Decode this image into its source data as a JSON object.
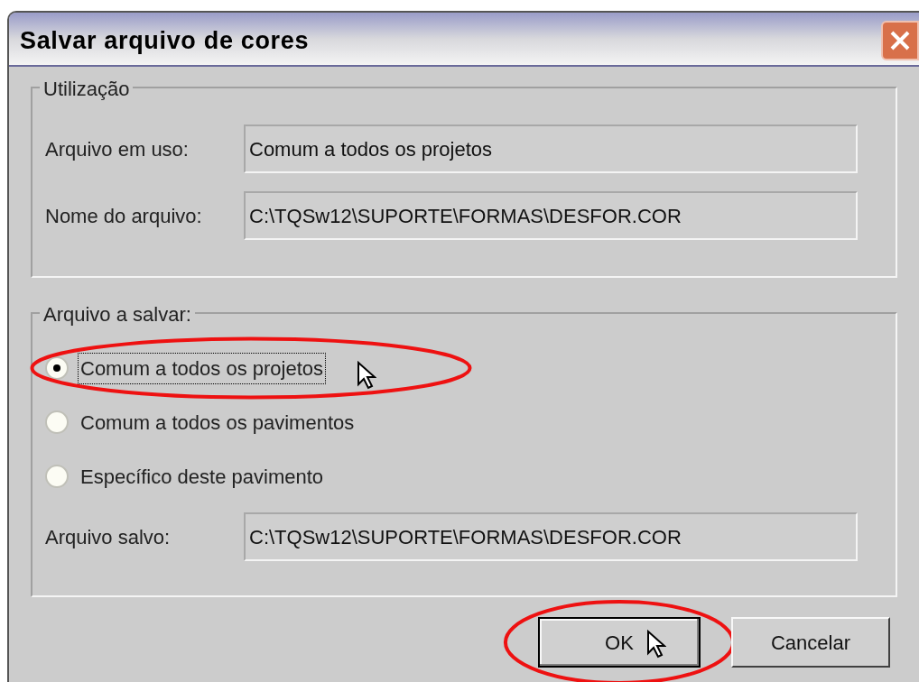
{
  "window": {
    "title": "Salvar arquivo de cores"
  },
  "usage_group": {
    "legend": "Utilização",
    "rows": [
      {
        "label": "Arquivo em uso:",
        "value": "Comum a todos os projetos"
      },
      {
        "label": "Nome do arquivo:",
        "value": "C:\\TQSw12\\SUPORTE\\FORMAS\\DESFOR.COR"
      }
    ]
  },
  "save_group": {
    "legend": "Arquivo a salvar:",
    "options": [
      {
        "label": "Comum a todos os projetos",
        "selected": true,
        "focused": true,
        "highlighted": true,
        "cursor": true
      },
      {
        "label": "Comum a todos os pavimentos",
        "selected": false,
        "focused": false,
        "highlighted": false,
        "cursor": false
      },
      {
        "label": "Específico deste pavimento",
        "selected": false,
        "focused": false,
        "highlighted": false,
        "cursor": false
      }
    ],
    "saved_label": "Arquivo salvo:",
    "saved_value": "C:\\TQSw12\\SUPORTE\\FORMAS\\DESFOR.COR"
  },
  "buttons": [
    {
      "label": "OK",
      "default": true,
      "highlighted": true,
      "cursor": true
    },
    {
      "label": "Cancelar",
      "default": false,
      "highlighted": false,
      "cursor": false
    }
  ]
}
